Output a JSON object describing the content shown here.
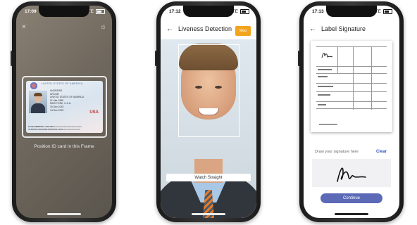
{
  "phones": [
    {
      "status_time": "17:09",
      "network": "LTE",
      "caption": "Position ID card in this Frame",
      "id_card": {
        "header": "UNITED STATES OF AMERICA",
        "surname": "ANDREWS",
        "given_name": "ARCHIE",
        "nationality": "UNITED STATES OF AMERICA",
        "dob": "01 Mar 1985",
        "place": "NEW YORK, U.S.A.",
        "issue": "15 Dec 2015",
        "expiry": "14 Dec 2025",
        "country_mark": "USA",
        "mrz_1": "P<USAANDREWS<<ARCHIE<<<<<<<<<<<<<<<<<<<<<<",
        "mrz_2": "3105602<4USA8503012M2512149<<<<<<<<<<<<<<"
      }
    },
    {
      "status_time": "17:12",
      "network": "LTE",
      "title": "Liveness Detection",
      "skip_label": "Skip",
      "instruction": "Watch Straight"
    },
    {
      "status_time": "17:13",
      "network": "LTE",
      "title": "Label Signature",
      "draw_label": "Draw your signature here",
      "clear_label": "Clear",
      "continue_label": "Continue"
    }
  ],
  "icons": {
    "back": "arrow-left",
    "close": "x",
    "flash": "sun"
  }
}
